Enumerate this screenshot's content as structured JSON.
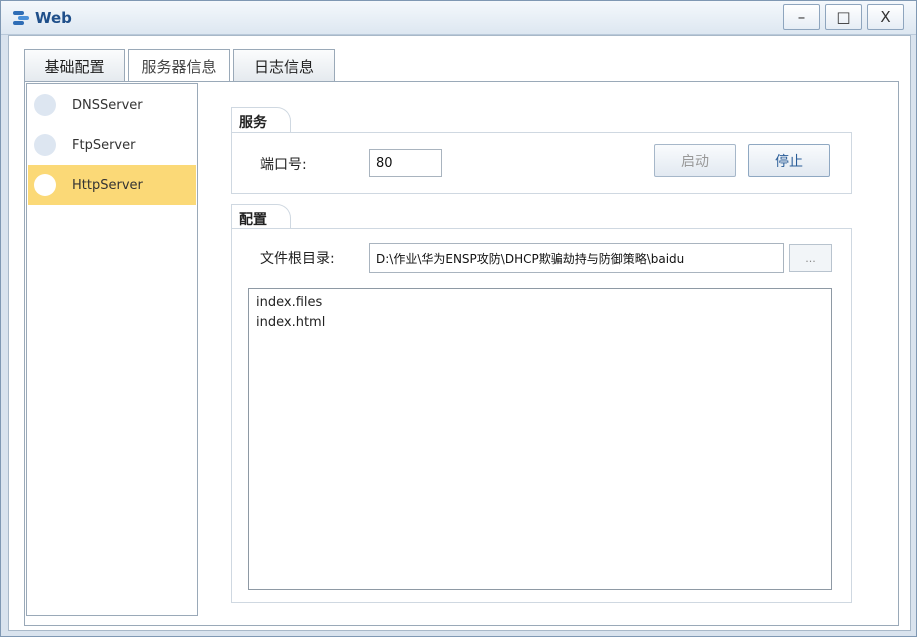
{
  "window": {
    "title": "Web",
    "min": "–",
    "max": "□",
    "close": "X"
  },
  "tabs": [
    {
      "label": "基础配置"
    },
    {
      "label": "服务器信息"
    },
    {
      "label": "日志信息"
    }
  ],
  "servers": [
    {
      "label": "DNSServer"
    },
    {
      "label": "FtpServer"
    },
    {
      "label": "HttpServer"
    }
  ],
  "service": {
    "group_title": "服务",
    "port_label": "端口号:",
    "port_value": "80",
    "start_label": "启动",
    "stop_label": "停止"
  },
  "config": {
    "group_title": "配置",
    "root_label": "文件根目录:",
    "root_value": "D:\\作业\\华为ENSP攻防\\DHCP欺骗劫持与防御策略\\baidu",
    "browse_label": "...",
    "files": [
      "index.files",
      "index.html"
    ]
  }
}
